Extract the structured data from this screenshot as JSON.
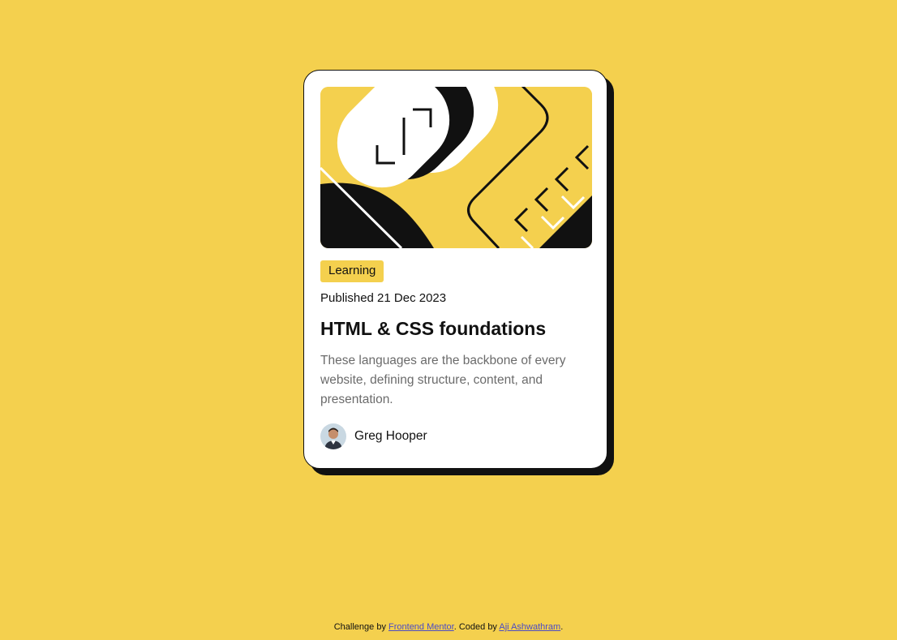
{
  "card": {
    "tag": "Learning",
    "published": "Published 21 Dec 2023",
    "title": "HTML & CSS foundations",
    "description": "These languages are the backbone of every website, defining structure, content, and presentation.",
    "author": {
      "name": "Greg Hooper"
    },
    "hero_illustration": "abstract-code-illustration"
  },
  "attribution": {
    "prefix": "Challenge by ",
    "challenge_link": "Frontend Mentor",
    "middle": ". Coded by ",
    "author_link": "Aji Ashwathram",
    "suffix": "."
  },
  "colors": {
    "background": "#F4D04E",
    "card": "#FFFFFF",
    "ink": "#111111",
    "muted_text": "#6B6B6B",
    "link": "#4B4BC6"
  }
}
